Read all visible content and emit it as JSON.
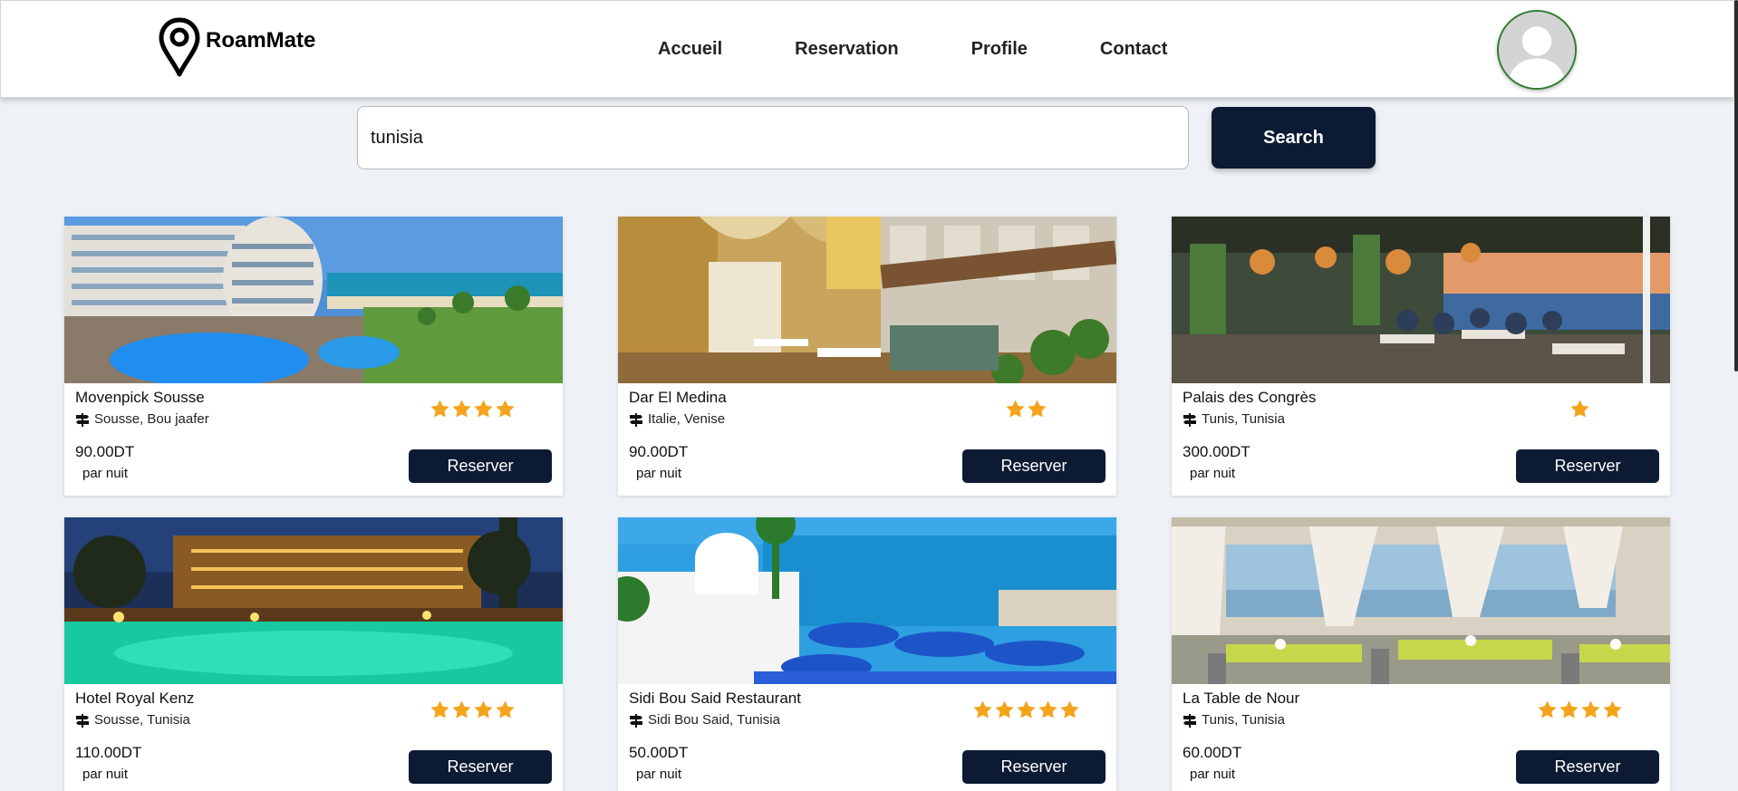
{
  "brand": {
    "name": "RoamMate"
  },
  "nav": {
    "items": [
      {
        "label": "Accueil"
      },
      {
        "label": "Reservation"
      },
      {
        "label": "Profile"
      },
      {
        "label": "Contact"
      }
    ]
  },
  "search": {
    "value": "tunisia",
    "button_label": "Search"
  },
  "colors": {
    "primary": "#0c1a33",
    "star": "#f4a41c",
    "avatar_ring": "#2f7d2f"
  },
  "cards": [
    {
      "name": "Movenpick Sousse",
      "location": "Sousse, Bou jaafer",
      "rating": 4,
      "price": "90.00DT",
      "unit": "par nuit",
      "button_label": "Reserver",
      "image": "hotel-pool-beach"
    },
    {
      "name": "Dar El Medina",
      "location": "Italie, Venise",
      "rating": 2,
      "price": "90.00DT",
      "unit": "par nuit",
      "button_label": "Reserver",
      "image": "venice-arcade"
    },
    {
      "name": "Palais des Congrès",
      "location": "Tunis, Tunisia",
      "rating": 1,
      "price": "300.00DT",
      "unit": "par nuit",
      "button_label": "Reserver",
      "image": "seaside-restaurant"
    },
    {
      "name": "Hotel Royal Kenz",
      "location": "Sousse, Tunisia",
      "rating": 4,
      "price": "110.00DT",
      "unit": "par nuit",
      "button_label": "Reserver",
      "image": "night-pool-hotel"
    },
    {
      "name": "Sidi Bou Said Restaurant",
      "location": "Sidi Bou Said, Tunisia",
      "rating": 5,
      "price": "50.00DT",
      "unit": "par nuit",
      "button_label": "Reserver",
      "image": "sidi-bou-said-view"
    },
    {
      "name": "La Table de Nour",
      "location": "Tunis, Tunisia",
      "rating": 4,
      "price": "60.00DT",
      "unit": "par nuit",
      "button_label": "Reserver",
      "image": "curtained-dining-room"
    }
  ]
}
